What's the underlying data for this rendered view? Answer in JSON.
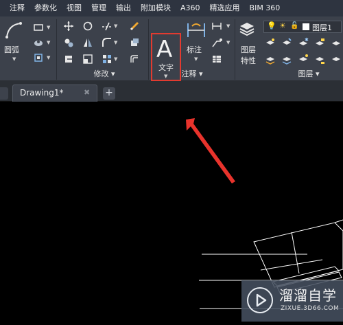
{
  "menubar": {
    "items": [
      "注释",
      "参数化",
      "视图",
      "管理",
      "输出",
      "附加模块",
      "A360",
      "精选应用",
      "BIM 360"
    ]
  },
  "ribbon": {
    "draw": {
      "arc_label": "圆弧"
    },
    "modify": {
      "panel_title": "修改"
    },
    "annotation": {
      "panel_title": "注释",
      "text_label": "文字",
      "text_glyph": "A",
      "dimension_label": "标注"
    },
    "layers": {
      "panel_title": "图层",
      "properties_label_1": "图层",
      "properties_label_2": "特性",
      "current_layer": "图层1"
    }
  },
  "tabs": {
    "drawing": "Drawing1*",
    "close_glyph": "✖",
    "new_glyph": "+"
  },
  "watermark": {
    "title": "溜溜自学",
    "subtitle": "ZIXUE.3D66.COM"
  },
  "colors": {
    "highlight": "#e23b30",
    "arrow": "#e8332c",
    "menubar_bg": "#2e3440",
    "ribbon_bg": "#3c414b"
  }
}
